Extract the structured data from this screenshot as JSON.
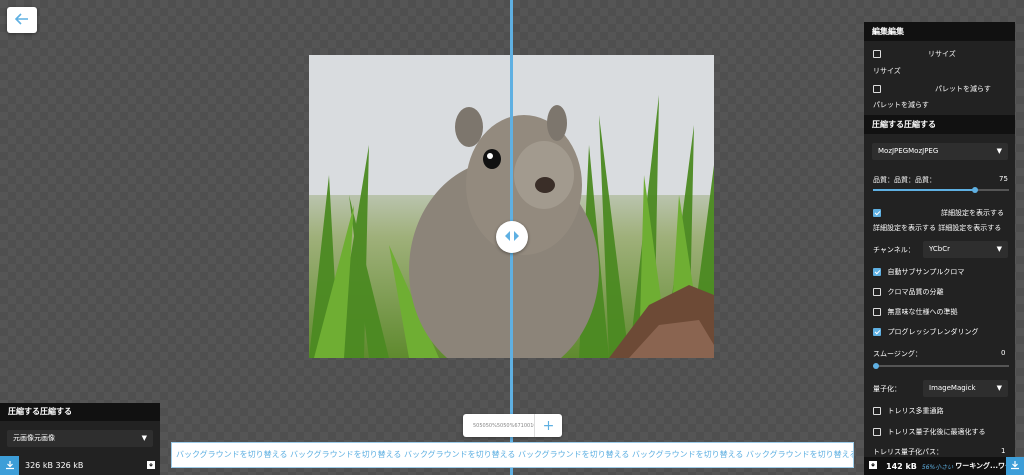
{
  "toolbar": {
    "back_icon": "arrow-left-icon"
  },
  "zoom": {
    "value_text": "505050%5050%6710010 0%%",
    "plus_label": "+"
  },
  "background_strip": {
    "text": "バックグラウンドを切り替える バックグラウンドを切り替える バックグラウンドを切り替える バックグラウンドを切り替える バックグラウンドを切り替える バックグラウンドを切り替える バックグラウンドを切り替える"
  },
  "left_panel": {
    "title": "圧縮する圧縮する",
    "select_value": "元画像元画像",
    "file_size": "326 kB 326 kB"
  },
  "right_panel": {
    "edit_title": "編集編集",
    "resize_label": "リサイズ",
    "resize_sublabel": "リサイズ",
    "reduce_palette_label": "パレットを減らす",
    "reduce_palette_sublabel": "パレットを減らす",
    "compress_title": "圧縮する圧縮する",
    "codec_value": "MozJPEGMozJPEG",
    "quality_label": "品質：品質：品質：",
    "quality_value": "75",
    "advanced_label": "詳細設定を表示する",
    "advanced_sublabel": "詳細設定を表示する 詳細設定を表示する",
    "channel_label": "チャンネル：",
    "channel_value": "YCbCr",
    "options": [
      {
        "label": "自動サブサンプルクロマ",
        "checked": true
      },
      {
        "label": "クロマ品質の分離",
        "checked": false
      },
      {
        "label": "無意味な仕様への準拠",
        "checked": false
      },
      {
        "label": "プログレッシブレンダリング",
        "checked": true
      }
    ],
    "smoothing_label": "スムージング：",
    "smoothing_value": "0",
    "quantize_label": "量子化：",
    "quantize_value": "ImageMagick",
    "trellis_options": [
      {
        "label": "トレリス多重通路",
        "checked": false
      },
      {
        "label": "トレリス量子化後に最適化する",
        "checked": false
      }
    ],
    "trellis_pass_label": "トレリス量子化パス：",
    "trellis_pass_value": "1",
    "footer": {
      "size": "142 kB",
      "percent": "56%小さい",
      "status": "ワーキング...ワー"
    }
  },
  "colors": {
    "accent": "#5fb0e2",
    "panel": "#222222",
    "panel_head": "#111111"
  }
}
